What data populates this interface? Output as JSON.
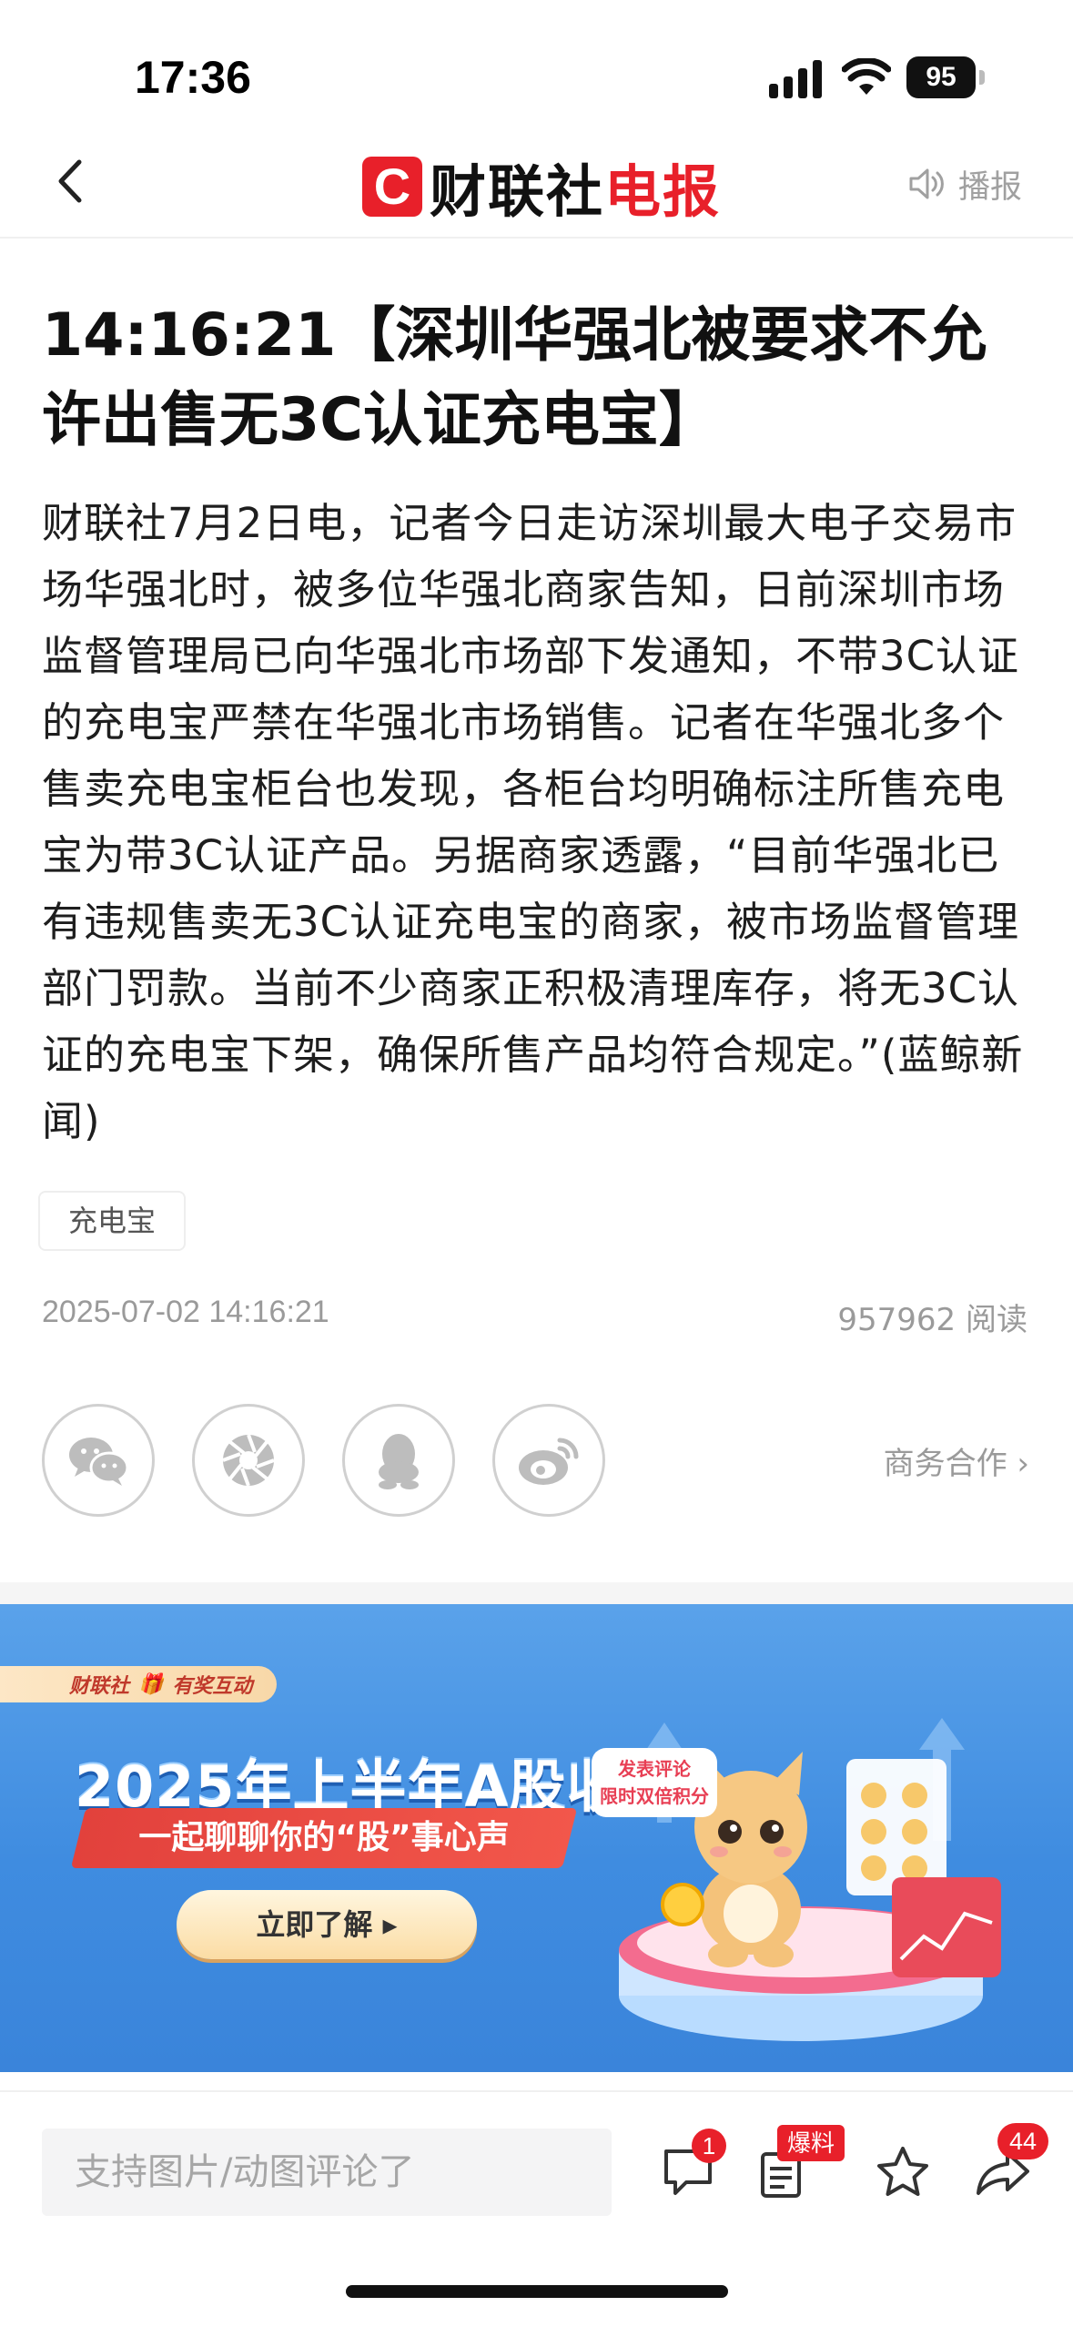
{
  "status_bar": {
    "time": "17:36",
    "battery": "95"
  },
  "nav": {
    "logo_letter": "C",
    "logo_text_black": "财联社",
    "logo_text_red": "电报",
    "broadcast_label": "播报"
  },
  "article": {
    "title": "14:16:21【深圳华强北被要求不允许出售无3C认证充电宝】",
    "body": "财联社7月2日电，记者今日走访深圳最大电子交易市场华强北时，被多位华强北商家告知，日前深圳市场监督管理局已向华强北市场部下发通知，不带3C认证的充电宝严禁在华强北市场销售。记者在华强北多个售卖充电宝柜台也发现，各柜台均明确标注所售充电宝为带3C认证产品。另据商家透露，“目前华强北已有违规售卖无3C认证充电宝的商家，被市场监督管理部门罚款。当前不少商家正积极清理库存，将无3C认证的充电宝下架，确保所售产品均符合规定。”(蓝鲸新闻)",
    "tag": "充电宝",
    "datetime": "2025-07-02 14:16:21",
    "reads": "957962 阅读"
  },
  "share": {
    "icons": [
      "wechat-icon",
      "moments-icon",
      "qq-icon",
      "weibo-icon"
    ],
    "business_link": "商务合作 ›"
  },
  "banner": {
    "badge_brand": "财联社",
    "badge_tag": "有奖互动",
    "headline": "2025年上半年A股收官",
    "subline": "一起聊聊你的“股”事心声",
    "cta": "立即了解 ▸",
    "promo_line1": "发表评论",
    "promo_line2": "限时双倍积分"
  },
  "bottom_bar": {
    "comment_placeholder": "支持图片/动图评论了",
    "comment_badge": "1",
    "report_badge": "爆料",
    "share_badge": "44"
  },
  "colors": {
    "brand_red": "#e8202a",
    "banner_blue": "#3f8ce0",
    "muted_gray": "#9a9a9a"
  }
}
